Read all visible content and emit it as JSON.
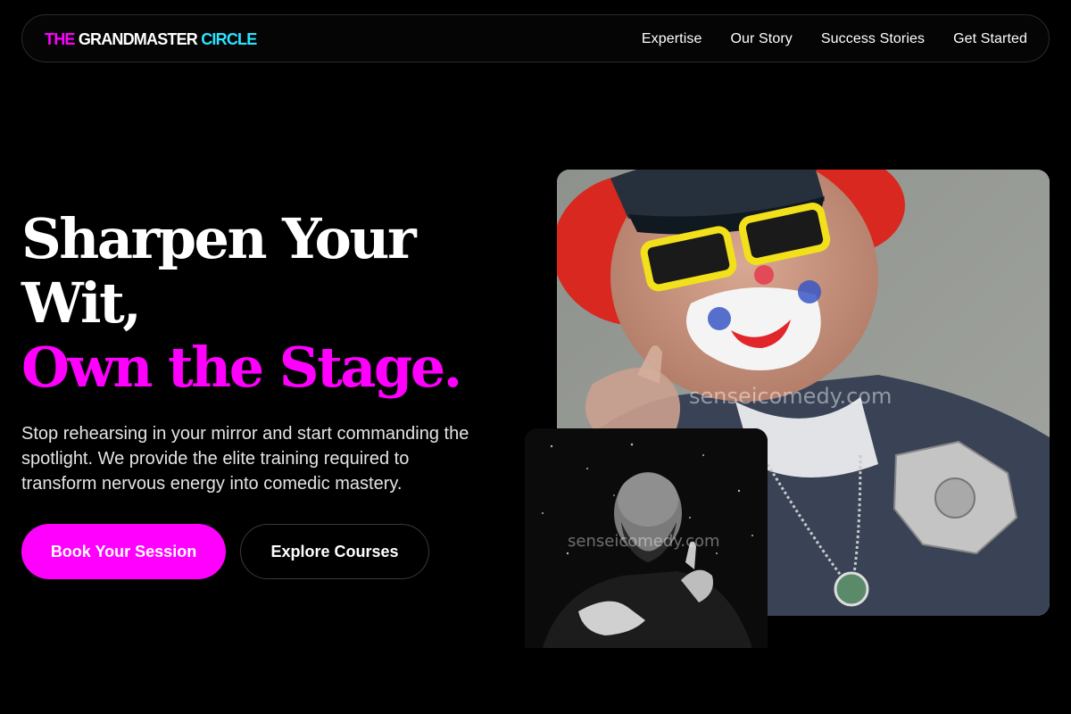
{
  "logo": {
    "part1": "THE",
    "part2": "GRANDMASTER",
    "part3": "CIRCLE"
  },
  "nav": {
    "links": [
      "Expertise",
      "Our Story",
      "Success Stories",
      "Get Started"
    ]
  },
  "hero": {
    "headline_line1": "Sharpen Your",
    "headline_line2": "Wit,",
    "headline_line3": "Own the Stage.",
    "lead": "Stop rehearsing in your mirror and start commanding the spotlight. We provide the elite training required to transform nervous energy into comedic mastery.",
    "primary_button": "Book Your Session",
    "secondary_button": "Explore Courses"
  },
  "images": {
    "main_watermark": "senseicomedy.com",
    "small_watermark": "senseicomedy.com"
  },
  "colors": {
    "accent_magenta": "#ff00ff",
    "accent_cyan": "#2de2ff",
    "background": "#000000"
  }
}
